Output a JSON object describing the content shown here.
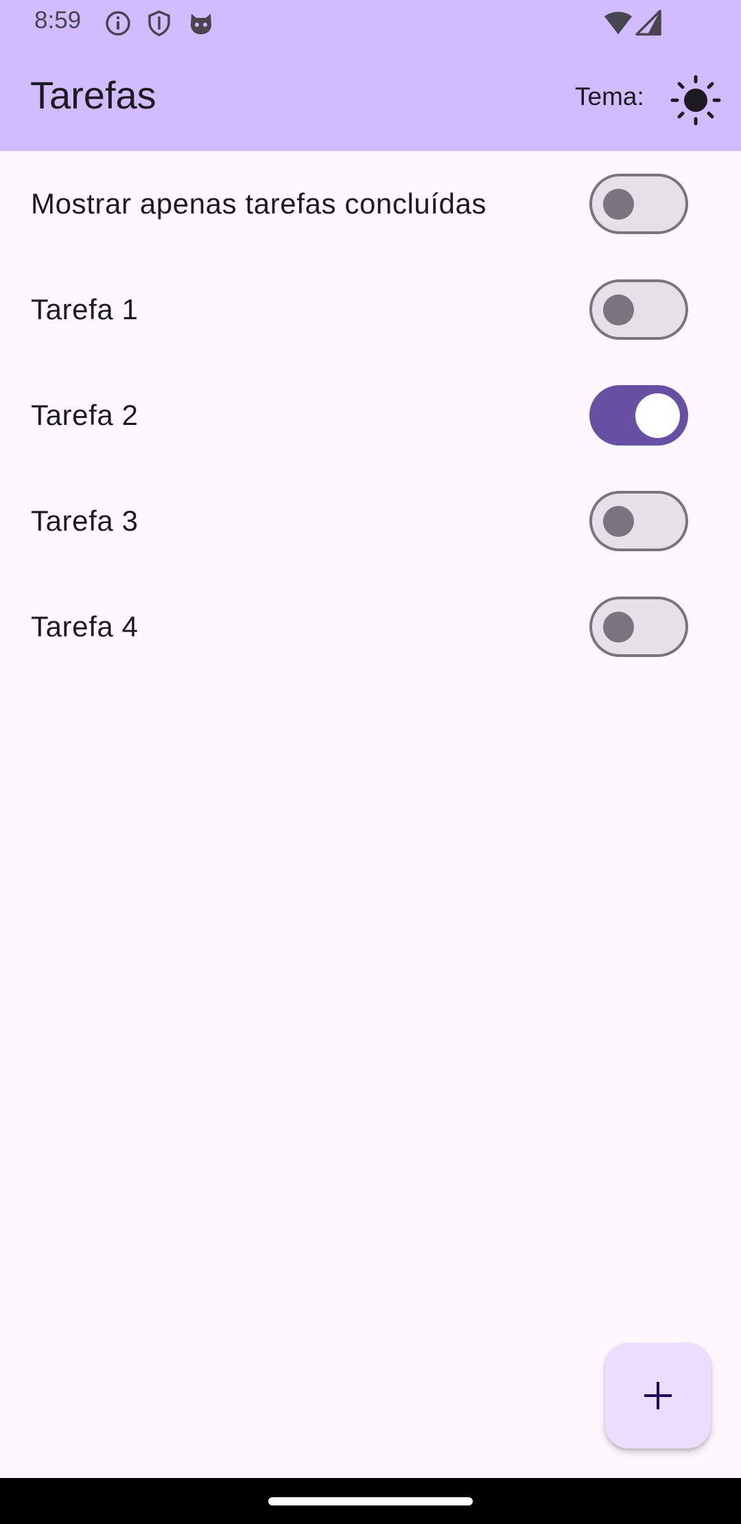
{
  "status_bar": {
    "time": "8:59",
    "icons": [
      "info-icon",
      "shield-icon",
      "cat-face-icon",
      "wifi-icon",
      "cellular-signal-icon"
    ]
  },
  "app_bar": {
    "title": "Tarefas",
    "theme_label": "Tema:",
    "theme_icon": "sun-icon"
  },
  "filter": {
    "label": "Mostrar apenas tarefas concluídas",
    "checked": false
  },
  "tasks": [
    {
      "label": "Tarefa 1",
      "done": false
    },
    {
      "label": "Tarefa 2",
      "done": true
    },
    {
      "label": "Tarefa 3",
      "done": false
    },
    {
      "label": "Tarefa 4",
      "done": false
    }
  ],
  "fab": {
    "icon": "plus-icon"
  },
  "colors": {
    "primary": "#6750A4",
    "app_bar": "#D0BCFF",
    "background": "#FFF7FE",
    "switch_off_track": "#E6E0E9",
    "switch_off_outline": "#79747E",
    "fab": "#EADDFF"
  }
}
